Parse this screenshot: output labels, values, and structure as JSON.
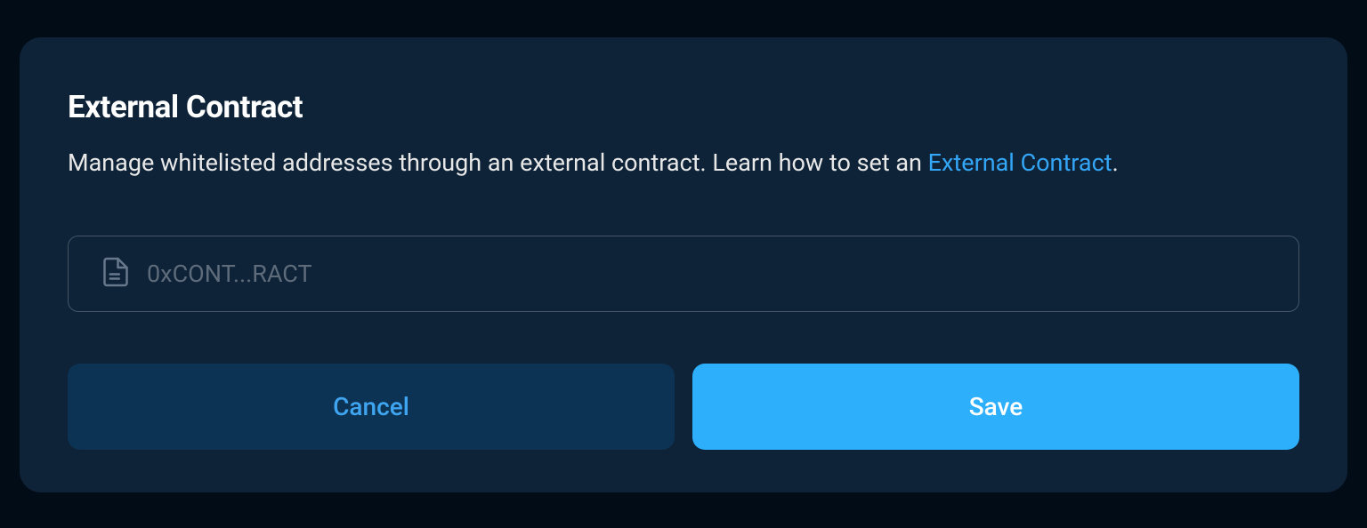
{
  "title": "External Contract",
  "description_prefix": "Manage whitelisted addresses through an external contract. Learn how to set an ",
  "description_link": "External Contract",
  "description_suffix": ".",
  "input": {
    "placeholder": "0xCONT...RACT",
    "value": ""
  },
  "buttons": {
    "cancel": "Cancel",
    "save": "Save"
  }
}
